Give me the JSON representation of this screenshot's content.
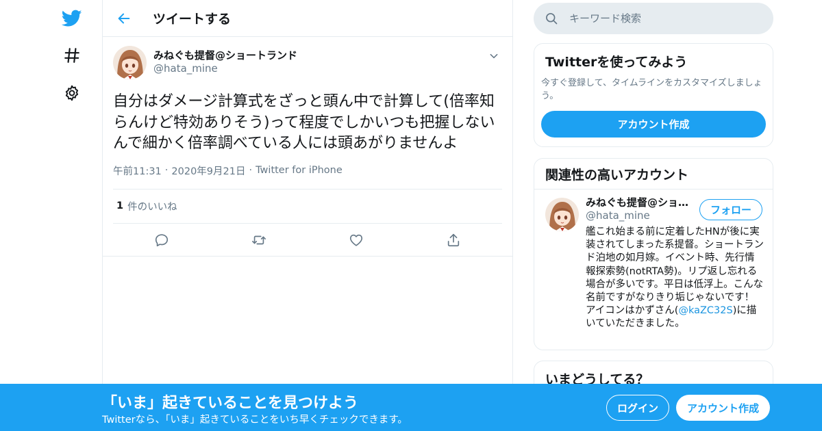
{
  "header": {
    "title": "ツイートする"
  },
  "tweet": {
    "display_name": "みねぐも提督@ショートランド",
    "handle": "@hata_mine",
    "text": "自分はダメージ計算式をざっと頭ん中で計算して(倍率知らんけど特効ありそう)って程度でしかいつも把握しないんで細かく倍率調べている人には頭あがりませんよ",
    "time": "午前11:31",
    "date": "2020年9月21日",
    "source": "Twitter for iPhone",
    "like_count": "1",
    "like_label": "件のいいね"
  },
  "search": {
    "placeholder": "キーワード検索"
  },
  "signup_card": {
    "title": "Twitterを使ってみよう",
    "subtitle": "今すぐ登録して、タイムラインをカスタマイズしましょう。",
    "button": "アカウント作成"
  },
  "related": {
    "title": "関連性の高いアカウント",
    "name": "みねぐも提督@ショートランド",
    "handle": "@hata_mine",
    "follow_button": "フォロー",
    "bio_before": "艦これ始まる前に定着したHNが後に実装されてしまった系提督。ショートランド泊地の如月嫁。イベント時、先行情報探索勢(notRTA勢)。リプ返し忘れる場合が多いです。平日は低浮上。こんな名前ですがなりきり垢じゃないです！アイコンはかずさん(",
    "bio_mention": "@kaZC32S",
    "bio_after": ")に描いていただきました。"
  },
  "trends": {
    "title": "いまどうしてる？"
  },
  "banner": {
    "title": "「いま」起きていることを見つけよう",
    "subtitle": "Twitterなら、「いま」起きていることをいち早くチェックできます。",
    "login": "ログイン",
    "signup": "アカウント作成"
  },
  "colors": {
    "accent": "#1da1f2",
    "secondary_text": "#657786",
    "border": "#e6ecf0"
  },
  "icons": [
    "twitter-bird-icon",
    "hashtag-icon",
    "gear-icon",
    "back-arrow-icon",
    "chevron-down-icon",
    "reply-icon",
    "retweet-icon",
    "like-icon",
    "share-icon",
    "search-icon"
  ]
}
